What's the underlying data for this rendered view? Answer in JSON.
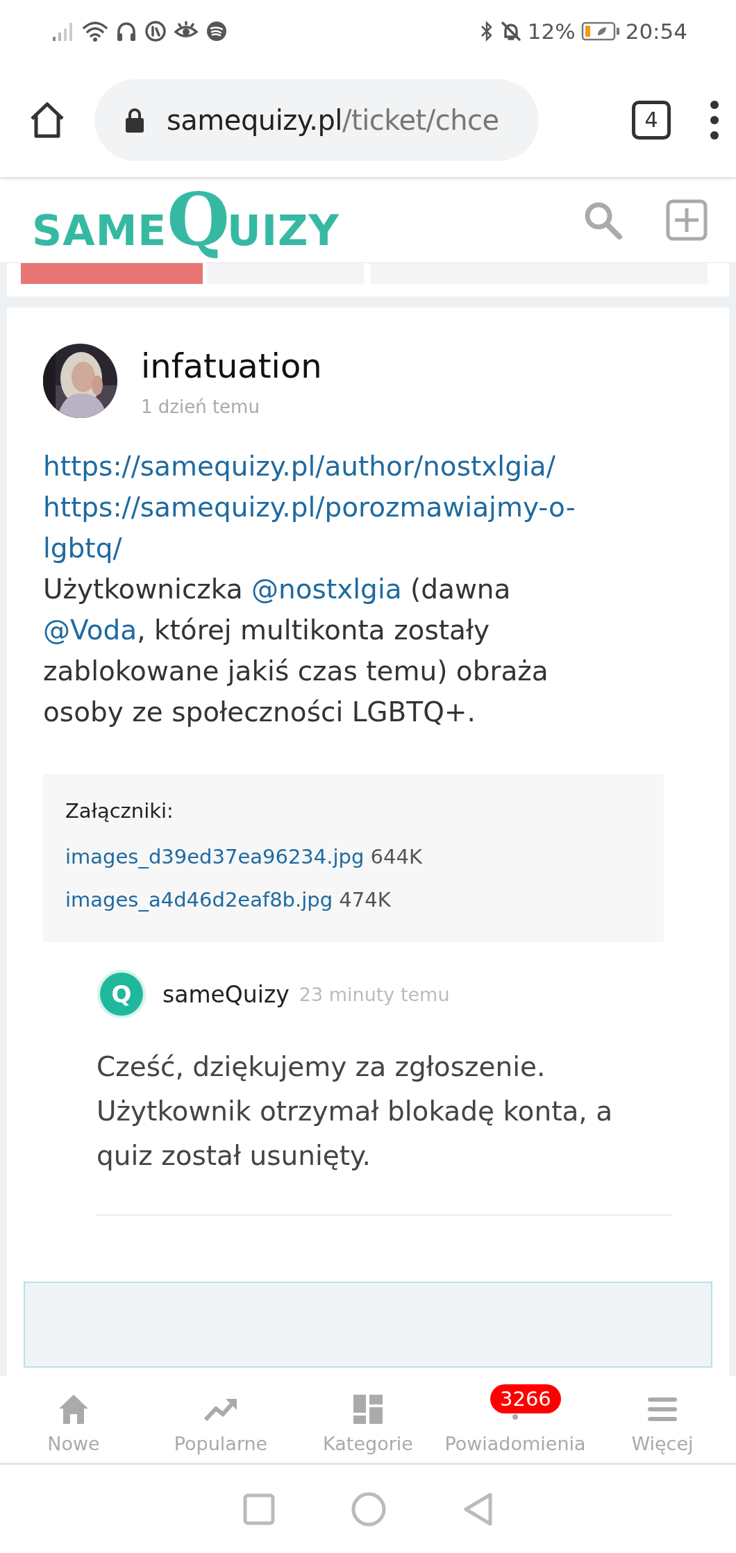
{
  "status_bar": {
    "battery": "12%",
    "time": "20:54"
  },
  "browser": {
    "url_host": "samequizy.pl",
    "url_path": "/ticket/chce",
    "tab_count": "4"
  },
  "site_header": {
    "logo": [
      "SAME",
      "Q",
      "UIZY"
    ]
  },
  "top_bars": [
    {
      "highlighted": true
    },
    {
      "highlighted": false
    },
    {
      "highlighted": false
    }
  ],
  "post": {
    "author": "infatuation",
    "time": "1 dzień temu",
    "links": [
      "https://samequizy.pl/author/nostxlgia/",
      "https://samequizy.pl/porozmawiajmy-o-lgbtq/"
    ],
    "body": [
      {
        "kind": "text",
        "text": "Użytkowniczka "
      },
      {
        "kind": "mention",
        "text": "@nostxlgia"
      },
      {
        "kind": "text",
        "text": " (dawna "
      },
      {
        "kind": "mention",
        "text": "@Voda"
      },
      {
        "kind": "text",
        "text": ", której multikonta zostały zablokowane jakiś czas temu) obraża osoby ze społeczności LGBTQ+."
      }
    ],
    "attachments": {
      "title": "Załączniki:",
      "files": [
        {
          "name": "images_d39ed37ea96234.jpg",
          "size": "644K"
        },
        {
          "name": "images_a4d46d2eaf8b.jpg",
          "size": "474K"
        }
      ]
    }
  },
  "reply": {
    "avatar_letter": "Q",
    "author": "sameQuizy",
    "time": "23 minuty temu",
    "text": "Cześć, dziękujemy za zgłoszenie. Użytkownik otrzymał blokadę konta, a quiz został usunięty."
  },
  "bottom_nav": [
    {
      "label": "Nowe"
    },
    {
      "label": "Popularne"
    },
    {
      "label": "Kategorie"
    },
    {
      "label": "Powiadomienia",
      "badge": "3266"
    },
    {
      "label": "Więcej"
    }
  ]
}
